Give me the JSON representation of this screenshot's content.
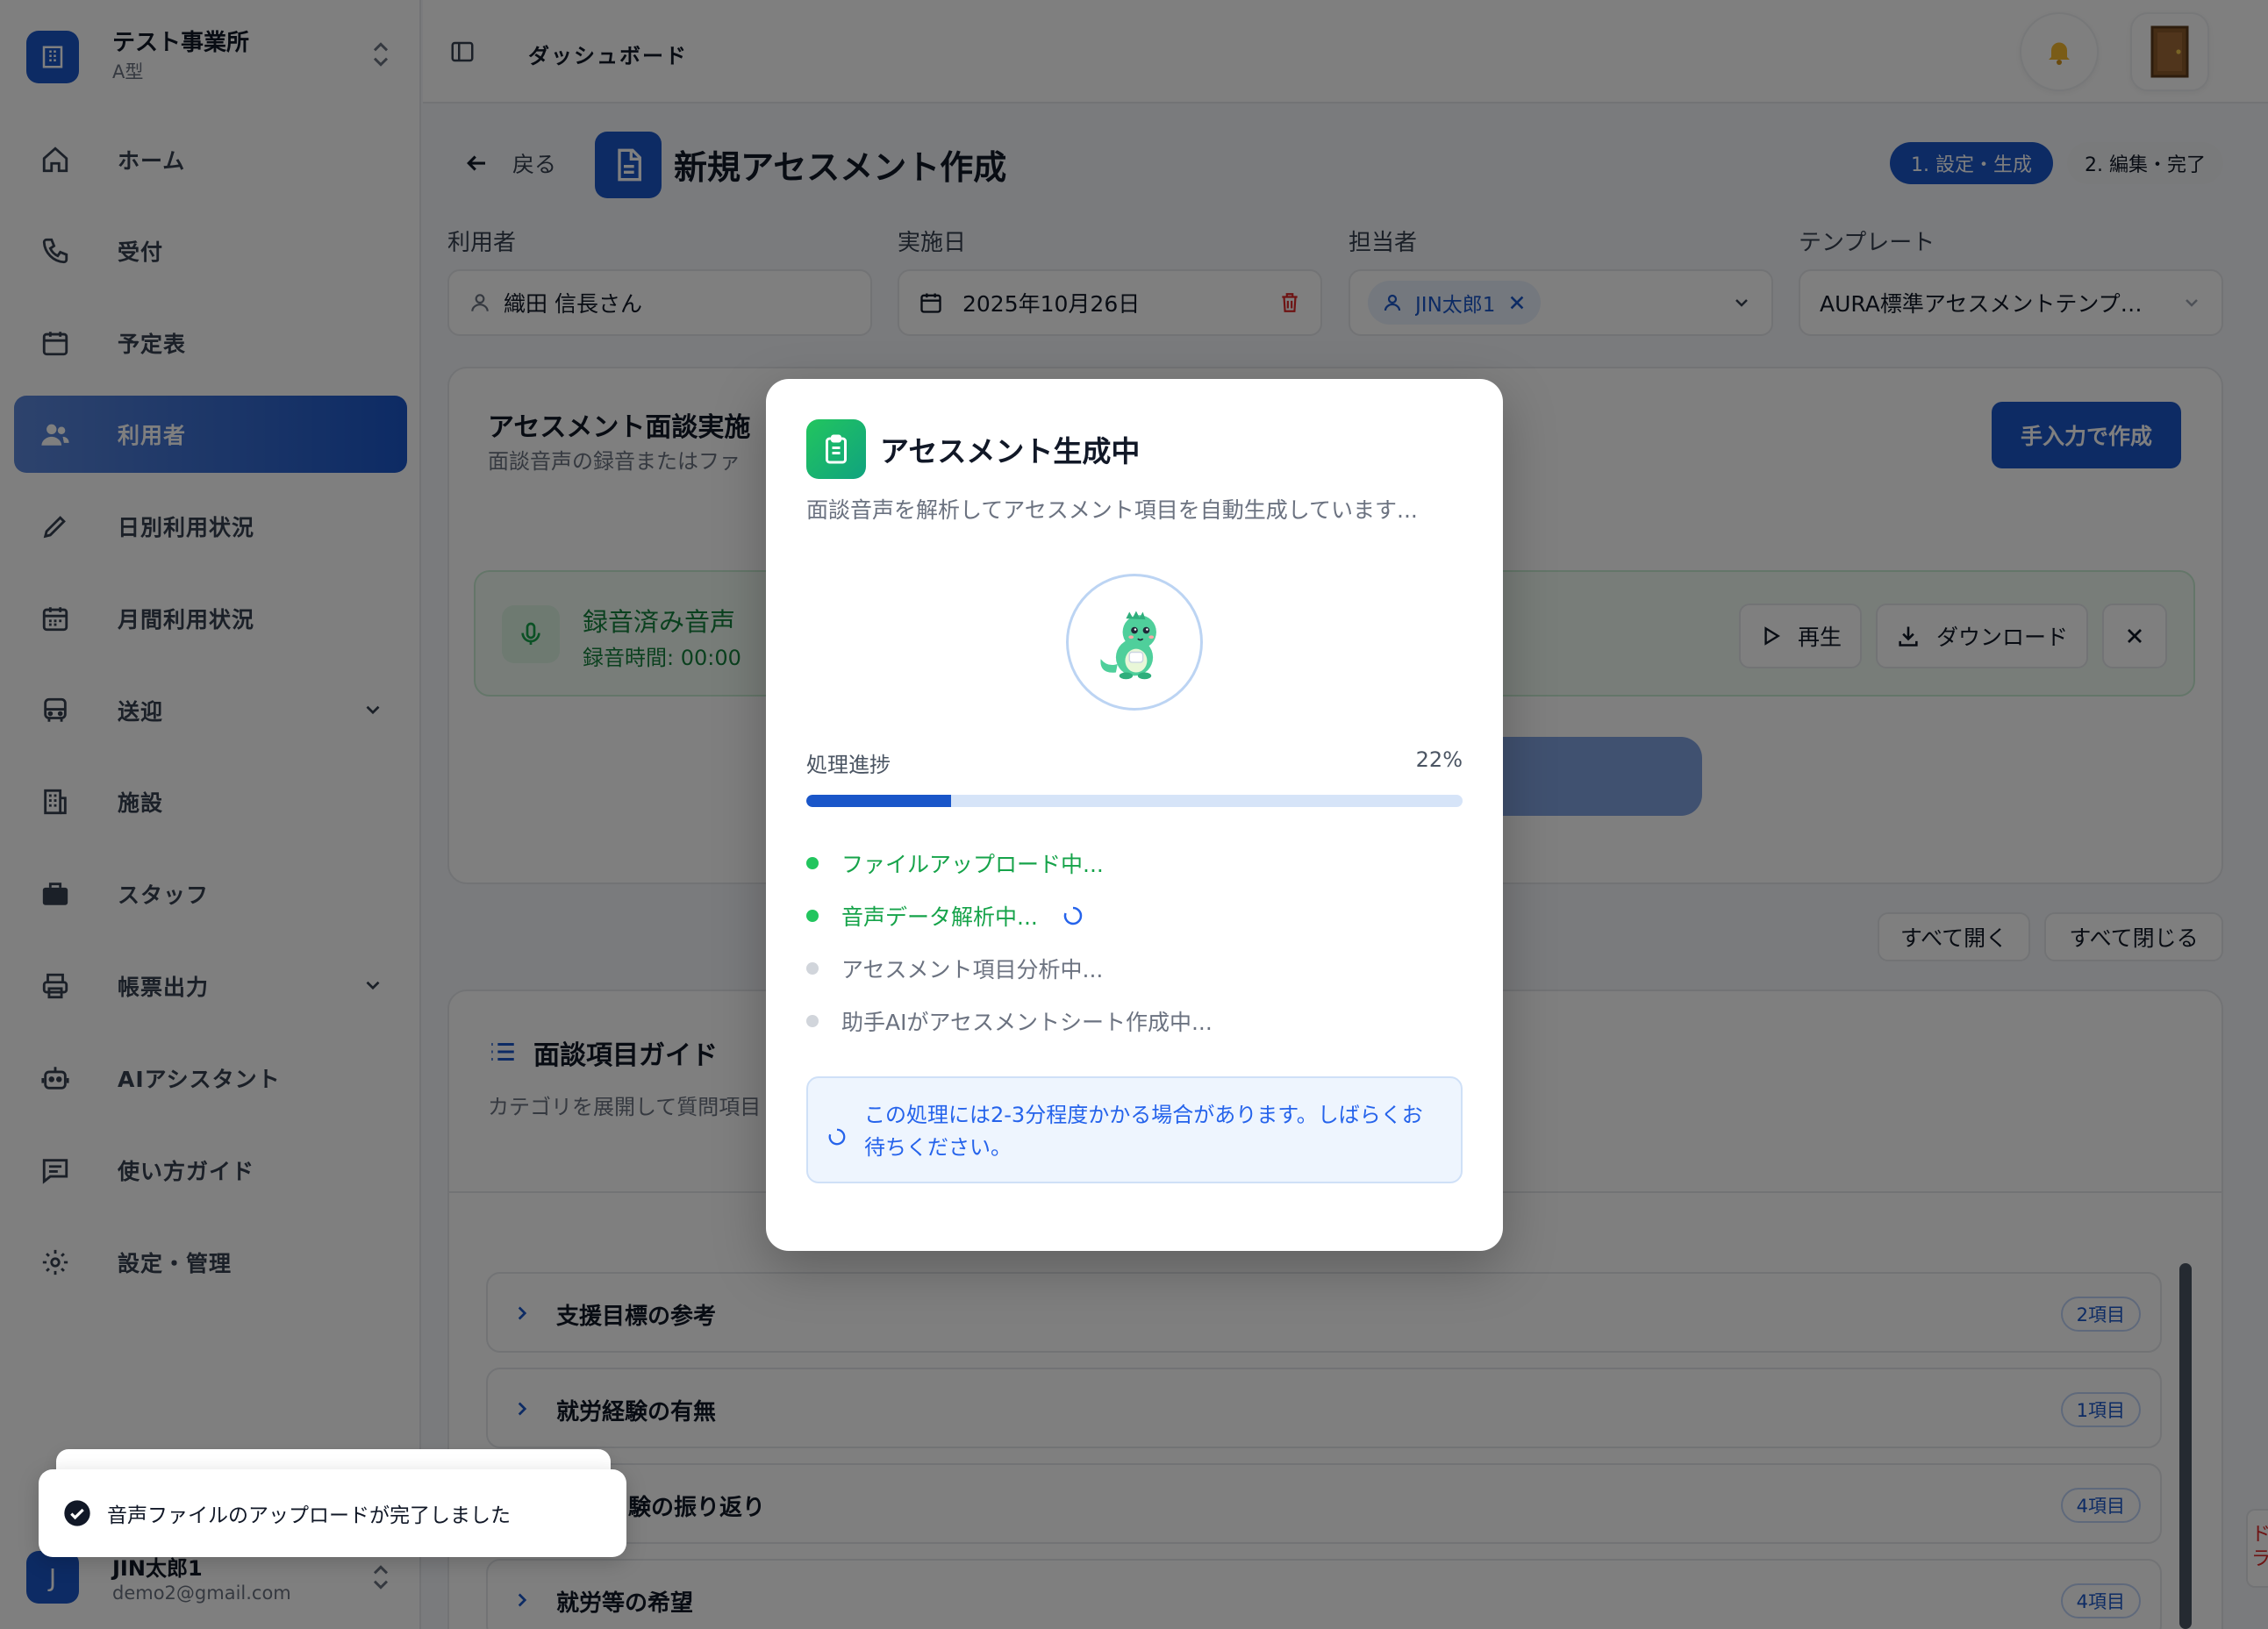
{
  "sidebar": {
    "org_name": "テスト事業所",
    "org_type": "A型",
    "items": [
      {
        "label": "ホーム",
        "icon": "home-icon"
      },
      {
        "label": "受付",
        "icon": "phone-icon"
      },
      {
        "label": "予定表",
        "icon": "calendar-icon"
      },
      {
        "label": "利用者",
        "icon": "users-icon",
        "active": true
      },
      {
        "label": "日別利用状況",
        "icon": "pencil-icon"
      },
      {
        "label": "月間利用状況",
        "icon": "calendar-grid-icon"
      },
      {
        "label": "送迎",
        "icon": "bus-icon",
        "expandable": true
      },
      {
        "label": "施設",
        "icon": "building-icon"
      },
      {
        "label": "スタッフ",
        "icon": "briefcase-icon"
      },
      {
        "label": "帳票出力",
        "icon": "printer-icon",
        "expandable": true
      },
      {
        "label": "AIアシスタント",
        "icon": "robot-icon"
      },
      {
        "label": "使い方ガイド",
        "icon": "message-icon"
      },
      {
        "label": "設定・管理",
        "icon": "gear-icon"
      }
    ],
    "user": {
      "initial": "J",
      "name": "JIN太郎1",
      "email": "demo2@gmail.com"
    }
  },
  "header": {
    "breadcrumb": "ダッシュボード"
  },
  "page": {
    "back_label": "戻る",
    "title": "新規アセスメント作成",
    "steps": [
      "1. 設定・生成",
      "2. 編集・完了"
    ],
    "fields": {
      "user_label": "利用者",
      "user_value": "織田 信長さん",
      "date_label": "実施日",
      "date_value": "2025年10月26日",
      "staff_label": "担当者",
      "staff_chip": "JIN太郎1",
      "template_label": "テンプレート",
      "template_value": "AURA標準アセスメントテンプ…"
    },
    "interview": {
      "title": "アセスメント面談実施",
      "subtitle": "面談音声の録音またはファ",
      "manual_button": "手入力で作成",
      "recording_title": "録音済み音声",
      "recording_time": "録音時間: 00:00",
      "play_label": "再生",
      "download_label": "ダウンロード"
    },
    "expand_all": "すべて開く",
    "collapse_all": "すべて閉じる",
    "guide": {
      "title": "面談項目ガイド",
      "subtitle": "カテゴリを展開して質問項目",
      "rows": [
        {
          "label": "支援目標の参考",
          "count": "2項目"
        },
        {
          "label": "就労経験の有無",
          "count": "1項目"
        },
        {
          "label": "験の振り返り",
          "count": "4項目"
        },
        {
          "label": "就労等の希望",
          "count": "4項目"
        }
      ]
    }
  },
  "modal": {
    "title": "アセスメント生成中",
    "description": "面談音声を解析してアセスメント項目を自動生成しています...",
    "progress_label": "処理進捗",
    "progress_text": "22%",
    "progress_value": 22,
    "steps": [
      {
        "label": "ファイルアップロード中...",
        "state": "done"
      },
      {
        "label": "音声データ解析中...",
        "state": "active"
      },
      {
        "label": "アセスメント項目分析中...",
        "state": "pending"
      },
      {
        "label": "助手AIがアセスメントシート作成中...",
        "state": "pending"
      }
    ],
    "note": "この処理には2-3分程度かかる場合があります。しばらくお待ちください。"
  },
  "toast": {
    "message": "音声ファイルのアップロードが完了しました"
  },
  "edge_peek": "ドラ",
  "colors": {
    "brand": "#1a56c9",
    "success": "#16a34a",
    "danger": "#dc2626"
  }
}
